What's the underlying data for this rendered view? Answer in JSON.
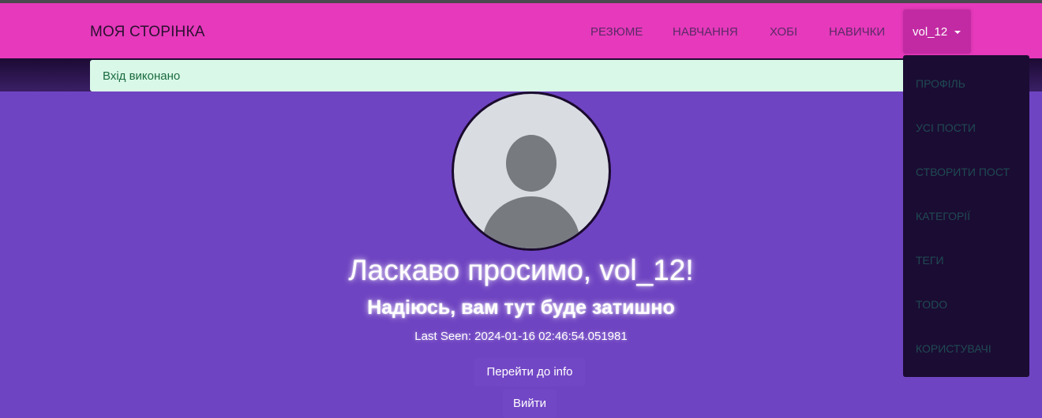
{
  "navbar": {
    "brand": "МОЯ СТОРІНКА",
    "links": [
      "РЕЗЮМЕ",
      "НАВЧАННЯ",
      "ХОБІ",
      "НАВИЧКИ"
    ],
    "user": "vol_12"
  },
  "alert": {
    "text": "Вхід виконано"
  },
  "dropdown": {
    "items": [
      "ПРОФІЛЬ",
      "УСІ ПОСТИ",
      "СТВОРИТИ ПОСТ",
      "КАТЕГОРІЇ",
      "ТЕГИ",
      "TODO",
      "КОРИСТУВАЧІ"
    ]
  },
  "main": {
    "welcome": "Ласкаво просимо, vol_12!",
    "subtitle": "Надіюсь, вам тут буде затишно",
    "last_seen": "Last Seen: 2024-01-16 02:46:54.051981",
    "info_button": "Перейти до info",
    "logout_button": "Вийти"
  },
  "colors": {
    "navbar": "#e639bb",
    "background": "#6f44c2",
    "dropdown": "#1b0c33",
    "alert_bg": "#d9f8e8"
  }
}
